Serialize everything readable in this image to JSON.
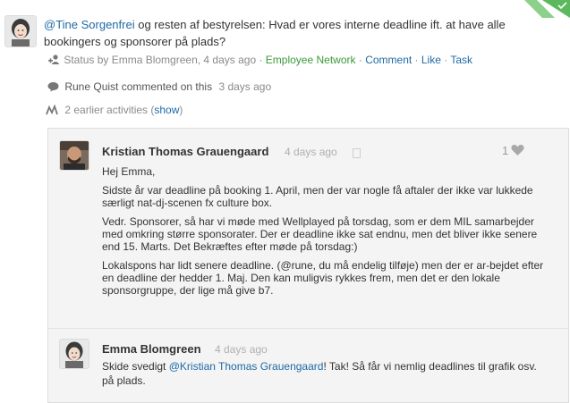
{
  "post": {
    "mention": "@Tine Sorgenfrei",
    "text": " og resten af bestyrelsen: Hvad er vores interne deadline ift. at have alle bookingers og sponsorer på plads?",
    "status_prefix": "Status by Emma Blomgreen, 4 days ago · ",
    "network": "Employee Network",
    "sep": " · ",
    "actions": [
      "Comment",
      "Like",
      "Task"
    ]
  },
  "activity": {
    "commenter": "Rune Quist commented on this",
    "time": "3 days ago"
  },
  "earlier": {
    "prefix": "2 earlier activities (",
    "link": "show",
    "suffix": ")"
  },
  "comments": [
    {
      "author": "Kristian Thomas Grauengaard",
      "time": "4 days ago",
      "likes": "1",
      "paragraphs": [
        "Hej Emma,",
        "Sidste år var deadline på booking 1. April, men der var nogle få aftaler der ikke var lukkede særligt nat-dj-scenen fx culture box.",
        "Vedr. Sponsorer, så har vi møde med Wellplayed på torsdag, som er dem MIL samarbejder med omkring større sponsorater. Der er deadline ikke sat endnu, men det bliver ikke senere end 15. Marts. Det Bekræftes efter møde på torsdag:)",
        "Lokalspons har lidt senere deadline. (@rune, du må endelig tilføje) men der er ar-bejdet efter en deadline der hedder 1. Maj. Den kan muligvis rykkes frem, men det er den lokale sponsorgruppe, der lige må give b7."
      ]
    },
    {
      "author": "Emma Blomgreen",
      "time": "4 days ago",
      "pre": "Skide svedigt ",
      "mention": "@Kristian Thomas Grauengaard",
      "post": "! Tak! Så får vi nemlig deadlines til grafik osv. på plads."
    }
  ],
  "colors": {
    "link": "#1f6aa5",
    "network": "#3a9a3a",
    "muted": "#8a8a8a",
    "thread_bg": "#f4f4f4"
  },
  "icons": [
    "status-icon",
    "comment-bubble-icon",
    "activity-icon",
    "heart-icon",
    "bookmark-icon",
    "corner-check-icon"
  ]
}
